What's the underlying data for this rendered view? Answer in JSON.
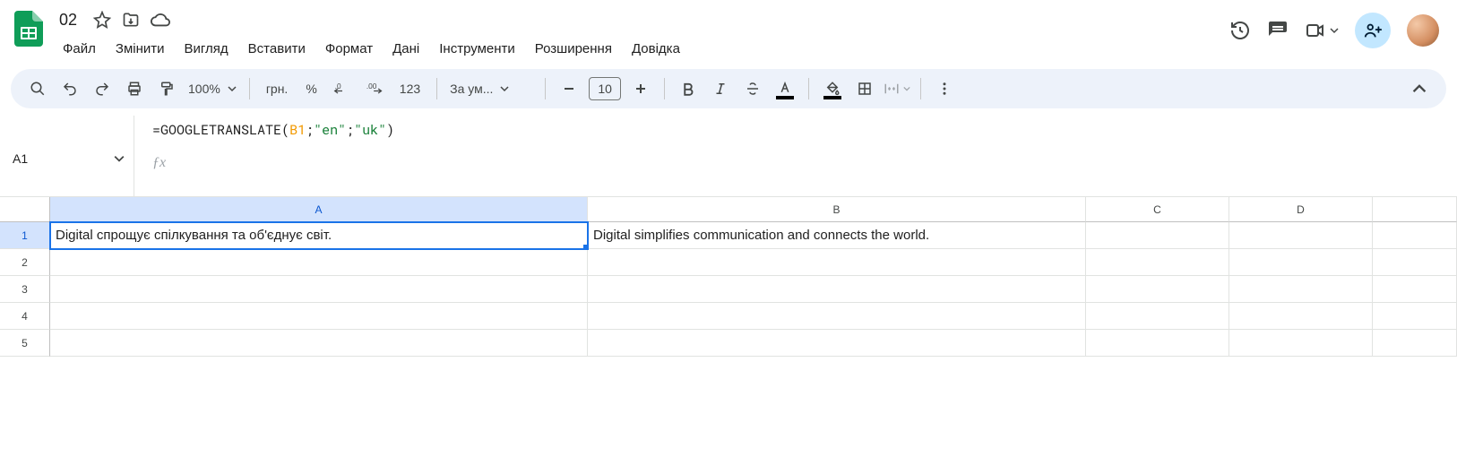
{
  "doc": {
    "title": "02"
  },
  "menus": [
    "Файл",
    "Змінити",
    "Вигляд",
    "Вставити",
    "Формат",
    "Дані",
    "Інструменти",
    "Розширення",
    "Довідка"
  ],
  "toolbar": {
    "zoom": "100%",
    "currency_label": "грн.",
    "percent_label": "%",
    "dec_dec_label": ".0",
    "inc_dec_label": ".00",
    "numfmt_label": "123",
    "font_label": "За ум...",
    "font_size": "10",
    "text_color": "#000000",
    "fill_color": "#000000"
  },
  "namebox": {
    "value": "A1"
  },
  "formula": {
    "eq": "=",
    "fn": "GOOGLETRANSLATE",
    "open": "(",
    "ref": "B1",
    "sep1": ";",
    "arg2": "\"en\"",
    "sep2": ";",
    "arg3": "\"uk\"",
    "close": ")"
  },
  "columns": [
    "A",
    "B",
    "C",
    "D",
    ""
  ],
  "rows": [
    "1",
    "2",
    "3",
    "4",
    "5"
  ],
  "cells": {
    "A1": "Digital спрощує спілкування та об'єднує світ.",
    "B1": "Digital simplifies communication and connects the world."
  }
}
